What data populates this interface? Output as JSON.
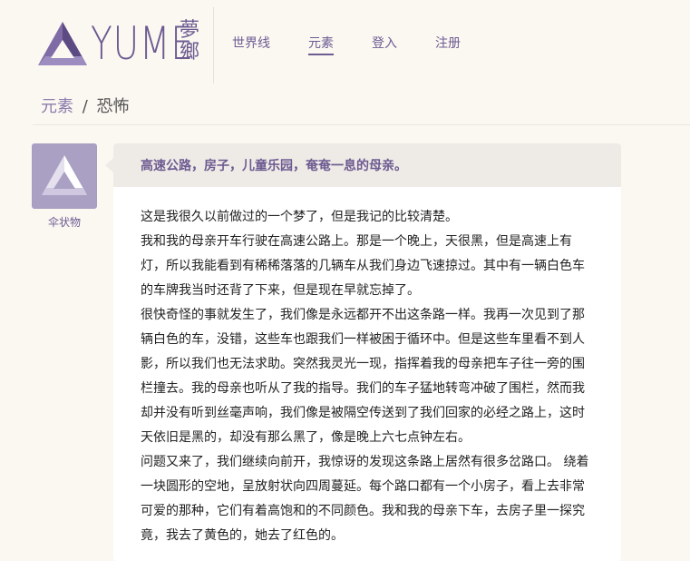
{
  "brand": {
    "name": "YUME",
    "cn": "夢鄉"
  },
  "nav": [
    {
      "label": "世界线"
    },
    {
      "label": "元素"
    },
    {
      "label": "登入"
    },
    {
      "label": "注册"
    }
  ],
  "breadcrumb": {
    "parent": "元素",
    "separator": "/",
    "current": "恐怖"
  },
  "author": {
    "name": "伞状物"
  },
  "post": {
    "title": "高速公路，房子，儿童乐园，奄奄一息的母亲。",
    "paragraphs": [
      "这是我很久以前做过的一个梦了，但是我记的比较清楚。",
      "我和我的母亲开车行驶在高速公路上。那是一个晚上，天很黑，但是高速上有灯，所以我能看到有稀稀落落的几辆车从我们身边飞速掠过。其中有一辆白色车的车牌我当时还背了下来，但是现在早就忘掉了。",
      "很快奇怪的事就发生了，我们像是永远都开不出这条路一样。我再一次见到了那辆白色的车，没错，这些车也跟我们一样被困于循环中。但是这些车里看不到人影，所以我们也无法求助。突然我灵光一现，指挥着我的母亲把车子往一旁的围栏撞去。我的母亲也听从了我的指导。我们的车子猛地转弯冲破了围栏，然而我却并没有听到丝毫声响，我们像是被隔空传送到了我们回家的必经之路上，这时天依旧是黑的，却没有那么黑了，像是晚上六七点钟左右。",
      "问题又来了，我们继续向前开，我惊讶的发现这条路上居然有很多岔路口。 绕着一块圆形的空地，呈放射状向四周蔓延。每个路口都有一个小房子，看上去非常可爱的那种，它们有着高饱和的不同颜色。我和我的母亲下车，去房子里一探究竟，我去了黄色的，她去了红色的。"
    ]
  },
  "colors": {
    "accent": "#6d5b91",
    "background": "#fbf8f2",
    "header_bar": "#eeebe6"
  }
}
